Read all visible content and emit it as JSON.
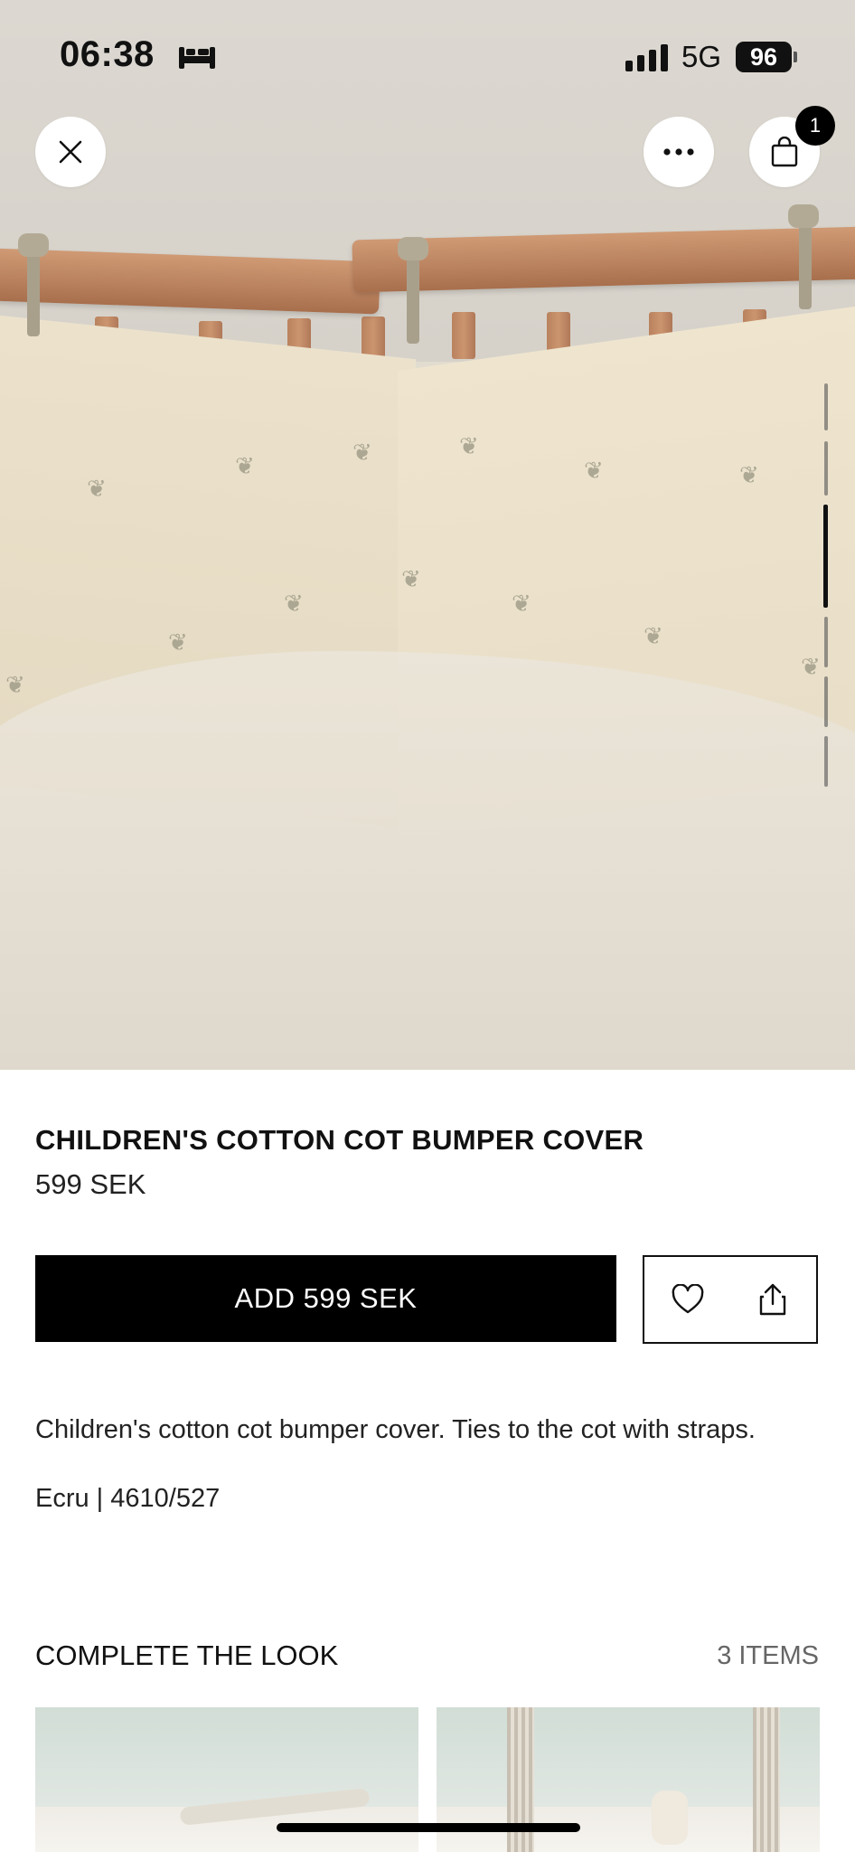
{
  "status_bar": {
    "time": "06:38",
    "network": "5G",
    "battery": "96"
  },
  "top_bar": {
    "cart_count": "1"
  },
  "gallery": {
    "image_alt": "Cot bumper cover tied to a wooden cot"
  },
  "product": {
    "title": "CHILDREN'S COTTON COT BUMPER COVER",
    "price": "599 SEK",
    "add_label": "ADD 599 SEK",
    "description": "Children's cotton cot bumper cover. Ties to the cot with straps.",
    "color_ref": "Ecru | 4610/527"
  },
  "complete_the_look": {
    "title": "COMPLETE THE LOOK",
    "count": "3 ITEMS"
  },
  "icons": [
    "close-icon",
    "more-icon",
    "bag-icon",
    "heart-icon",
    "share-icon",
    "bed-icon"
  ],
  "colors": {
    "accent": "#000000",
    "background": "#ffffff",
    "muted_text": "#666666"
  }
}
